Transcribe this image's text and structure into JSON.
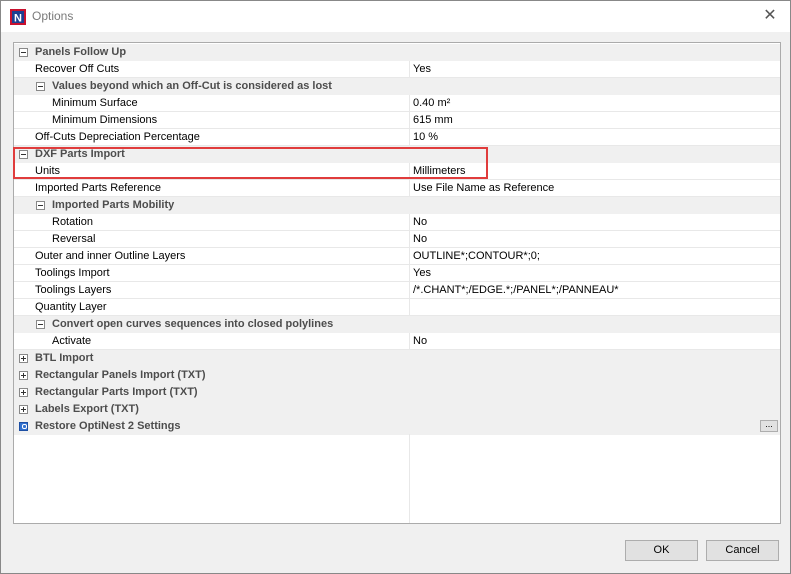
{
  "window": {
    "title": "Options",
    "close_glyph": "✕",
    "app_icon": "optinest-logo",
    "app_icon_letter": "N"
  },
  "grid": {
    "rows": [
      {
        "level": 0,
        "type": "category",
        "toggle": "minus",
        "label": "Panels Follow Up",
        "value": ""
      },
      {
        "level": 1,
        "type": "property",
        "label": "Recover Off Cuts",
        "value": "Yes"
      },
      {
        "level": 1,
        "type": "category",
        "toggle": "minus",
        "label": "Values beyond which an Off-Cut is considered as lost",
        "value": ""
      },
      {
        "level": 2,
        "type": "property",
        "label": "Minimum Surface",
        "value": "0.40 m²"
      },
      {
        "level": 2,
        "type": "property",
        "label": "Minimum Dimensions",
        "value": "615 mm"
      },
      {
        "level": 1,
        "type": "property",
        "label": "Off-Cuts Depreciation Percentage",
        "value": "10 %"
      },
      {
        "level": 0,
        "type": "category",
        "toggle": "minus",
        "label": "DXF Parts Import",
        "value": ""
      },
      {
        "level": 1,
        "type": "property",
        "label": "Units",
        "value": "Millimeters"
      },
      {
        "level": 1,
        "type": "property",
        "label": "Imported Parts Reference",
        "value": "Use File Name as Reference"
      },
      {
        "level": 1,
        "type": "category",
        "toggle": "minus",
        "label": "Imported Parts Mobility",
        "value": ""
      },
      {
        "level": 2,
        "type": "property",
        "label": "Rotation",
        "value": "No"
      },
      {
        "level": 2,
        "type": "property",
        "label": "Reversal",
        "value": "No"
      },
      {
        "level": 1,
        "type": "property",
        "label": "Outer and inner Outline Layers",
        "value": "OUTLINE*;CONTOUR*;0;"
      },
      {
        "level": 1,
        "type": "property",
        "label": "Toolings Import",
        "value": "Yes"
      },
      {
        "level": 1,
        "type": "property",
        "label": "Toolings Layers",
        "value": "/*.CHANT*;/EDGE.*;/PANEL*;/PANNEAU*"
      },
      {
        "level": 1,
        "type": "property",
        "label": "Quantity Layer",
        "value": ""
      },
      {
        "level": 1,
        "type": "category",
        "toggle": "minus",
        "label": "Convert open curves sequences into closed polylines",
        "value": ""
      },
      {
        "level": 2,
        "type": "property",
        "label": "Activate",
        "value": "No"
      },
      {
        "level": 0,
        "type": "category",
        "toggle": "plus",
        "label": "BTL Import",
        "value": ""
      },
      {
        "level": 0,
        "type": "category",
        "toggle": "plus",
        "label": "Rectangular Panels Import (TXT)",
        "value": ""
      },
      {
        "level": 0,
        "type": "category",
        "toggle": "plus",
        "label": "Rectangular Parts Import (TXT)",
        "value": ""
      },
      {
        "level": 0,
        "type": "category",
        "toggle": "plus",
        "label": "Labels Export (TXT)",
        "value": ""
      },
      {
        "level": 0,
        "type": "action",
        "toggle": "restore",
        "label": "Restore OptiNest 2 Settings",
        "value": "",
        "button": "..."
      }
    ]
  },
  "buttons": {
    "ok": "OK",
    "cancel": "Cancel"
  },
  "colors": {
    "highlight": "#e03c3c",
    "category_bg": "#f0f0f0"
  }
}
